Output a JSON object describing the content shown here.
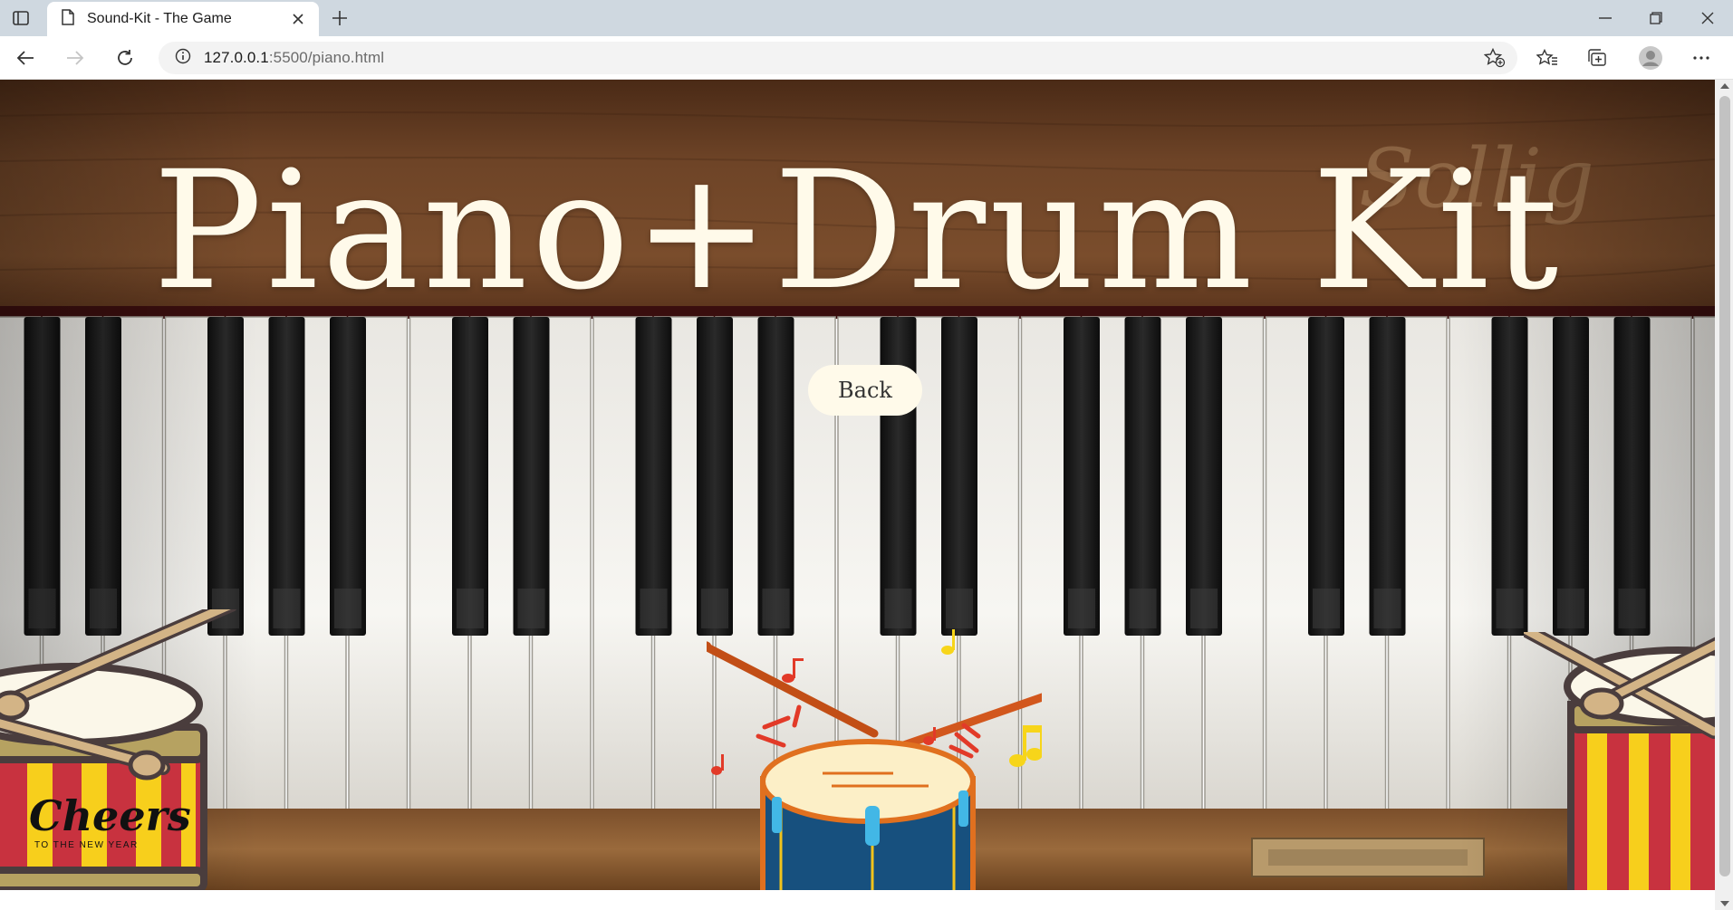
{
  "browser": {
    "tab_title": "Sound-Kit - The Game",
    "url_host": "127.0.0.1",
    "url_rest": ":5500/piano.html",
    "icons": [
      "tab-actions-icon",
      "page-icon",
      "close-icon",
      "plus-icon",
      "minimize-icon",
      "restore-icon",
      "close-window-icon",
      "back-icon",
      "forward-icon",
      "refresh-icon",
      "info-icon",
      "add-favorite-icon",
      "favorites-icon",
      "collections-icon",
      "profile-icon",
      "more-icon"
    ]
  },
  "page": {
    "title": "Piano+Drum Kit",
    "back_label": "Back",
    "cheers_script": "Cheers",
    "cheers_sub": "TO THE NEW YEAR"
  },
  "colors": {
    "title": "#fffaea",
    "button_bg": "#fffaea",
    "wood": "#6b4125",
    "drum_red": "#c8323f",
    "drum_yellow": "#f7cf1c",
    "drum_blue": "#17507e",
    "stick_orange": "#d2571d"
  }
}
